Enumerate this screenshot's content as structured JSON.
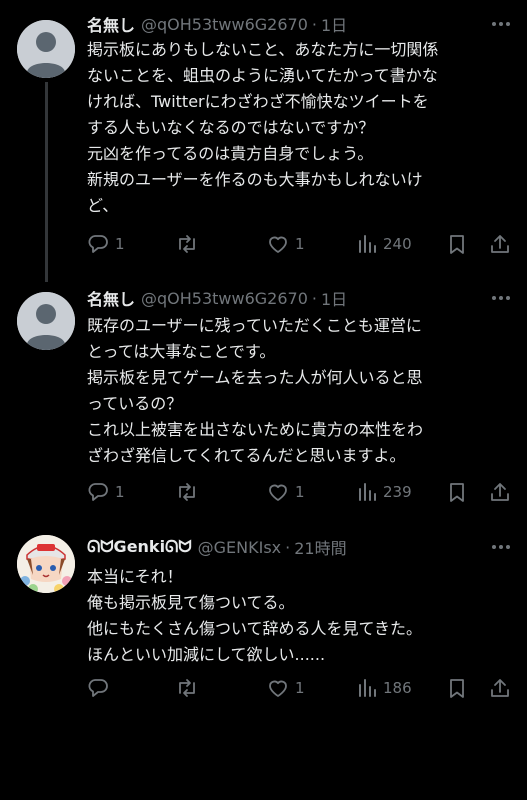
{
  "tweets": [
    {
      "name": "名無し",
      "handle": "@qOH53tww6G2670",
      "sep": "·",
      "time": "1日",
      "lines": [
        "掲示板にありもしないこと、あなた方に一切関係",
        "ないことを、蛆虫のように湧いてたかって書かな",
        "ければ、Twitterにわざわざ不愉快なツイートを",
        "する人もいなくなるのではないですか？",
        "元凶を作ってるのは貴方自身でしょう。",
        "新規のユーザーを作るのも大事かもしれないけ",
        "ど、"
      ],
      "replies": "1",
      "likes": "1",
      "views": "240"
    },
    {
      "name": "名無し",
      "handle": "@qOH53tww6G2670",
      "sep": "·",
      "time": "1日",
      "lines": [
        "既存のユーザーに残っていただくことも運営に",
        "とっては大事なことです。",
        "掲示板を見てゲームを去った人が何人いると思",
        "っているの？",
        "これ以上被害を出さないために貴方の本性をわ",
        "ざわざ発信してくれてるんだと思いますよ。"
      ],
      "replies": "1",
      "likes": "1",
      "views": "239"
    },
    {
      "name": "ᘏᗢGenkiᘏᗢ",
      "handle": "@GENKIsx",
      "sep": "·",
      "time": "21時間",
      "lines": [
        "本当にそれ！",
        "俺も掲示板見て傷ついてる。",
        "他にもたくさん傷ついて辞める人を見てきた。",
        "ほんといい加減にして欲しい......"
      ],
      "replies": "",
      "likes": "1",
      "views": "186"
    }
  ]
}
